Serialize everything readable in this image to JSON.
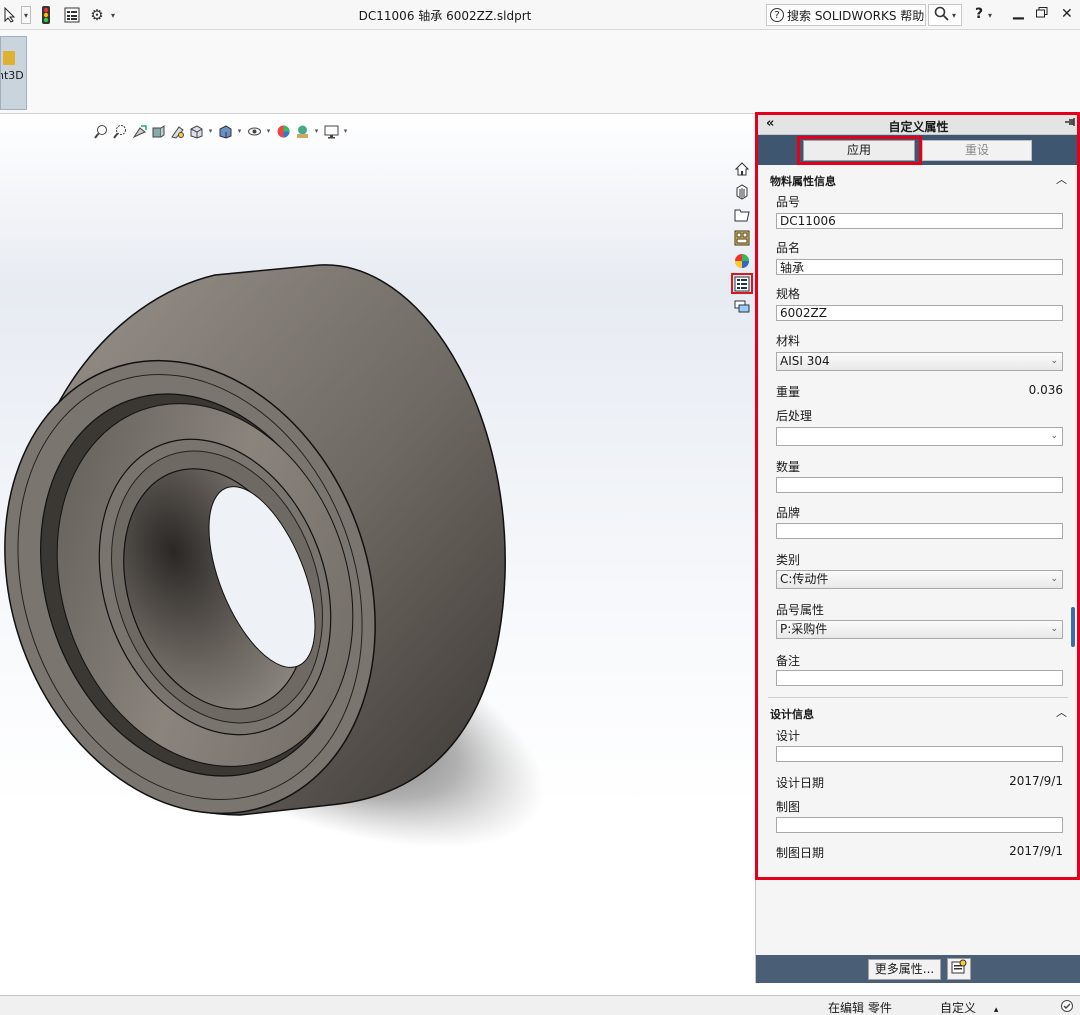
{
  "titlebar": {
    "document_title": "DC11006 轴承 6002ZZ.sldprt",
    "help_search_label": "搜索 SOLIDWORKS 帮助",
    "help_question": "?"
  },
  "ribbon": {
    "addin_label": "nt3D"
  },
  "taskpane": {
    "title": "自定义属性",
    "collapse_glyph": "«",
    "apply_label": "应用",
    "reset_label": "重设",
    "sections": {
      "material": {
        "title": "物料属性信息",
        "part_number_label": "品号",
        "part_number_value": "DC11006",
        "part_name_label": "品名",
        "part_name_value": "轴承",
        "spec_label": "规格",
        "spec_value": "6002ZZ",
        "material_label": "材料",
        "material_value": "AISI 304",
        "weight_label": "重量",
        "weight_value": "0.036",
        "post_process_label": "后处理",
        "post_process_value": "",
        "quantity_label": "数量",
        "quantity_value": "",
        "brand_label": "品牌",
        "brand_value": "",
        "category_label": "类别",
        "category_value": "C:传动件",
        "pn_attr_label": "品号属性",
        "pn_attr_value": "P:采购件",
        "remark_label": "备注",
        "remark_value": ""
      },
      "design": {
        "title": "设计信息",
        "designer_label": "设计",
        "designer_value": "",
        "design_date_label": "设计日期",
        "design_date_value": "2017/9/1",
        "drafter_label": "制图",
        "drafter_value": "",
        "draft_date_label": "制图日期",
        "draft_date_value": "2017/9/1"
      }
    },
    "more_props_label": "更多属性..."
  },
  "statusbar": {
    "mode": "在编辑 零件",
    "units": "自定义",
    "units_arrow": "▴"
  },
  "colors": {
    "highlight": "#e3001b",
    "panel_bar": "#3e566f",
    "part_body": "#7d7670"
  },
  "icons": [
    "select-icon",
    "traffic-light-icon",
    "property-manager-icon",
    "options-gear-icon",
    "search-icon",
    "minimize-icon",
    "restore-icon",
    "close-icon",
    "home-icon",
    "parts-library-icon",
    "file-explorer-icon",
    "view-palette-icon",
    "appearances-icon",
    "custom-properties-icon",
    "forum-icon",
    "zoom-to-fit-icon",
    "zoom-area-icon",
    "previous-view-icon",
    "section-view-icon",
    "dynamic-annotation-icon",
    "view-orientation-icon",
    "display-style-icon",
    "hide-show-icon",
    "edit-appearance-icon",
    "apply-scene-icon",
    "view-settings-icon",
    "pin-icon"
  ]
}
